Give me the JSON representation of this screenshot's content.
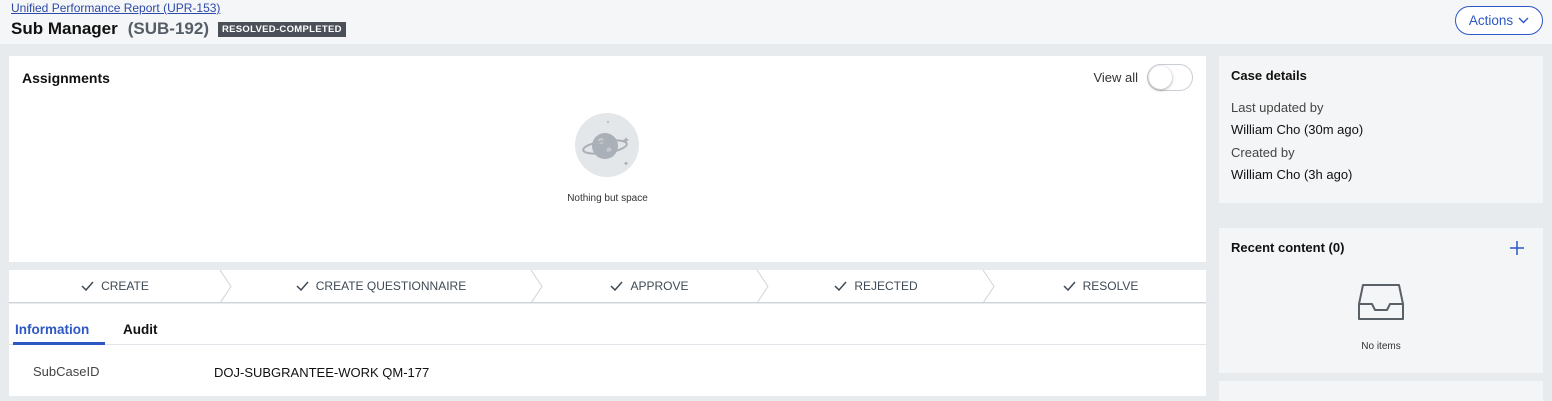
{
  "header": {
    "breadcrumb": "Unified Performance Report (UPR-153)",
    "title": "Sub Manager",
    "case_id": "(SUB-192)",
    "status": "RESOLVED-COMPLETED",
    "actions_label": "Actions"
  },
  "assignments": {
    "heading": "Assignments",
    "view_all_label": "View all",
    "view_all_on": false,
    "empty_text": "Nothing but space"
  },
  "stages": [
    {
      "label": "CREATE",
      "done": true
    },
    {
      "label": "CREATE QUESTIONNAIRE",
      "done": true
    },
    {
      "label": "APPROVE",
      "done": true
    },
    {
      "label": "REJECTED",
      "done": true
    },
    {
      "label": "RESOLVE",
      "done": true
    }
  ],
  "tabs": [
    {
      "label": "Information",
      "active": true
    },
    {
      "label": "Audit",
      "active": false
    }
  ],
  "fields": [
    {
      "label": "SubCaseID",
      "value": "DOJ-SUBGRANTEE-WORK QM-177"
    }
  ],
  "case_details": {
    "heading": "Case details",
    "last_updated_label": "Last updated by",
    "last_updated_value": "William Cho (30m ago)",
    "created_label": "Created by",
    "created_value": "William Cho (3h ago)"
  },
  "recent_content": {
    "title": "Recent content (0)",
    "empty_text": "No items"
  },
  "icons": {
    "actions": "chevron-down-icon",
    "stage": "check-icon",
    "add": "plus-icon",
    "empty_assignments": "planet-icon",
    "empty_recent": "inbox-tray-icon"
  },
  "colors": {
    "accent": "#2d58c4",
    "status_badge": "#4b5058",
    "page_bg": "#e8ebee"
  }
}
